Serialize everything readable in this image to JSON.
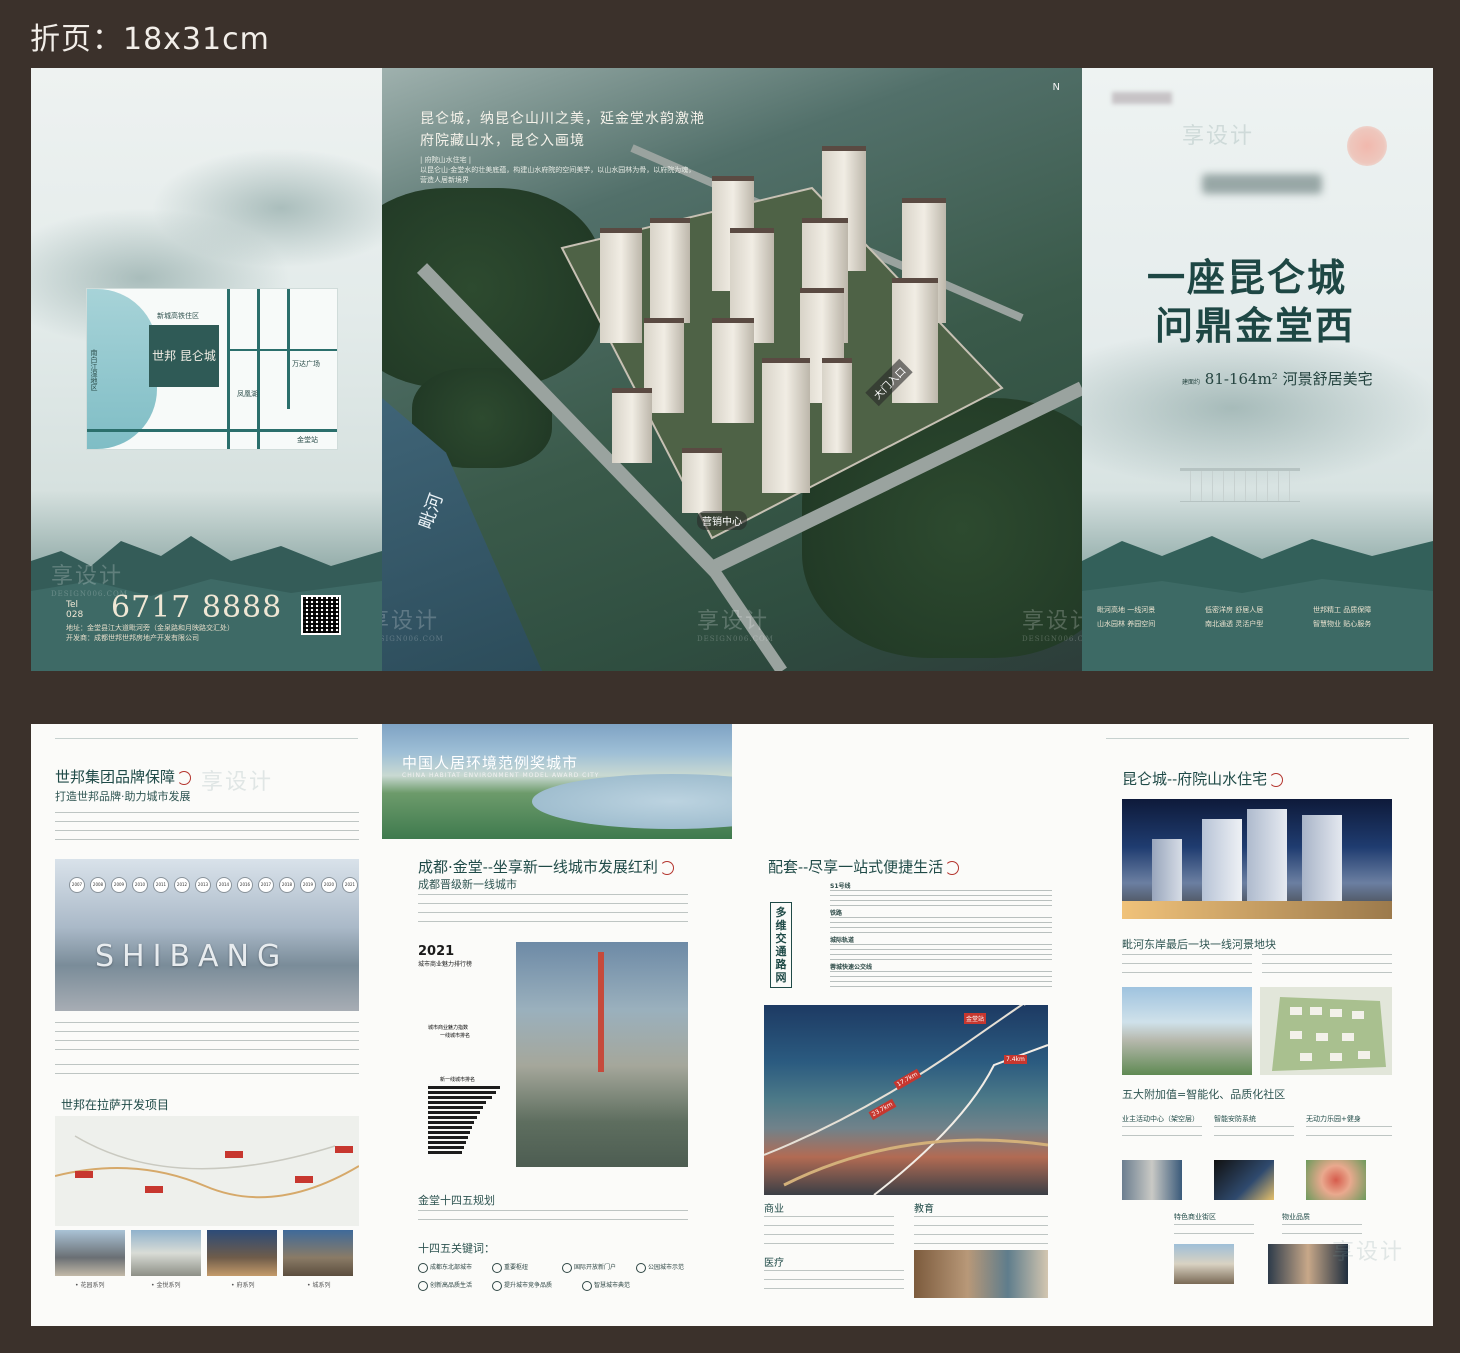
{
  "page_label": "折页：18x31cm",
  "cover_left": {
    "map": {
      "center_label": "世邦 昆仑城",
      "labels": [
        "新城高铁住区",
        "南白江湿地区",
        "凤凰湖",
        "万达广场",
        "金堂站",
        "毗河"
      ]
    },
    "tel_prefix": "Tel",
    "tel_area": "028",
    "phone": "6717 8888",
    "address": "地址：金堂县江大道毗河旁（金泉路和月映路交汇处）",
    "developer": "开发商：成都世邦世邦房地产开发有限公司"
  },
  "cover_middle": {
    "title_line1": "昆仑城，纳昆仑山川之美，延金堂水韵激滟",
    "title_line2": "府院藏山水，昆仑入画境",
    "subtitle_tag": "| 府院山水住宅 |",
    "subtitle_text": "以昆仑山·金堂水的壮美底蕴，构建山水府院的空间美学，以山水园林为骨，以府院为魂，营造人居新境界",
    "river_label": "毗河",
    "gate_label": "大门入口",
    "sales_label": "营销中心",
    "compass": "N"
  },
  "cover_right": {
    "headline_line1": "一座昆仑城",
    "headline_line2": "问鼎金堂西",
    "area_prefix": "建面约",
    "area": "81-164m² 河景舒居美宅",
    "features": [
      "毗河高地 一线河景",
      "低密洋房 舒居人居",
      "世邦精工 品质保障",
      "山水园林 养园空间",
      "南北通透 灵活户型",
      "智慧物业 贴心服务"
    ]
  },
  "page1": {
    "title": "世邦集团品牌保障",
    "subtitle": "打造世邦品牌·助力城市发展",
    "timeline_years": [
      "2007",
      "2008",
      "2009",
      "2010",
      "2011",
      "2012",
      "2013",
      "2014",
      "2016",
      "2017",
      "2018",
      "2019",
      "2020",
      "2021"
    ],
    "banner_word": "SHIBANG",
    "map_title": "世邦在拉萨开发项目",
    "thumb_captions": [
      "• 花园系列",
      "• 金悦系列",
      "• 府系列",
      "• 城系列"
    ]
  },
  "page2": {
    "banner_title": "中国人居环境范例奖城市",
    "banner_subtitle": "CHINA HABITAT ENVIRONMENT MODEL AWARD CITY",
    "title": "成都·金堂--坐享新一线城市发展红利",
    "subtitle": "成都晋级新一线城市",
    "rank_year": "2021",
    "rank_title": "城市商业魅力排行榜",
    "rank_sub1": "城市商业魅力指数",
    "rank_sub2": "一线城市排名",
    "rank_sub3": "新一线城市排名",
    "plan_title": "金堂十四五规划",
    "keywords_title": "十四五关键词：",
    "keywords": [
      "成都东北部城市",
      "重要枢纽",
      "国际开放新门户",
      "公园城市示范",
      "创新高品质生活",
      "提升城市竞争品质",
      "智慧城市典范"
    ]
  },
  "page3": {
    "title": "配套--尽享一站式便捷生活",
    "vertical_label": "多维交通路网",
    "transit_titles": [
      "S1号线",
      "铁路",
      "城际轨道",
      "蓉城快速公交线"
    ],
    "rail_labels": [
      "金堂站",
      "17.7km",
      "23.7km",
      "7.4km"
    ],
    "services": [
      "商业",
      "教育",
      "医疗"
    ]
  },
  "page4": {
    "title": "昆仑城--府院山水住宅",
    "riverside_title": "毗河东岸最后一块一线河景地块",
    "value_title": "五大附加值=智能化、品质化社区",
    "features": [
      "业主活动中心（架空层）",
      "智能安防系统",
      "无动力乐园+健身",
      "特色商业街区",
      "物业品质"
    ]
  },
  "watermark": "享设计",
  "watermark_sub": "DESIGN006.COM"
}
